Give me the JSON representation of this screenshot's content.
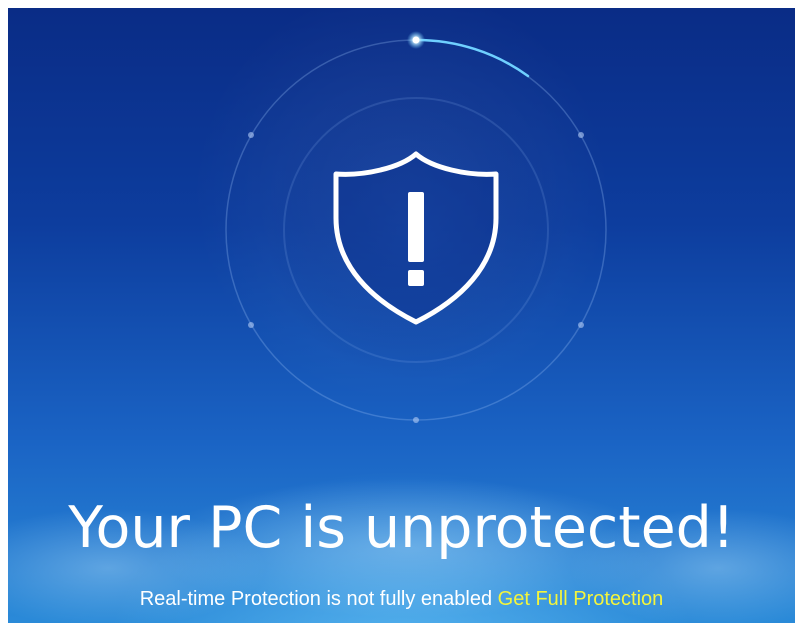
{
  "status": {
    "headline": "Your PC is unprotected!",
    "message": "Real-time Protection is not fully enabled",
    "action_link": "Get Full Protection"
  },
  "icons": {
    "shield": "shield-exclamation-icon",
    "scan_ring": "scan-ring-icon"
  },
  "colors": {
    "background_top": "#0a2c86",
    "background_bottom": "#2a8ad8",
    "text": "#ffffff",
    "link": "#f4f53c",
    "ring_accent": "#6fd0ff"
  }
}
